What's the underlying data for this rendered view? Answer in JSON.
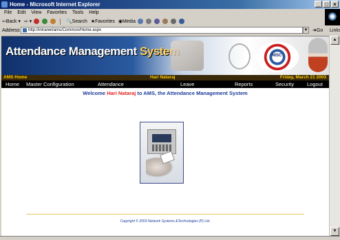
{
  "window": {
    "title": "Home - Microsoft Internet Explorer"
  },
  "menu": {
    "items": [
      "File",
      "Edit",
      "View",
      "Favorites",
      "Tools",
      "Help"
    ]
  },
  "toolbar": {
    "back_label": "Back",
    "search_label": "Search",
    "favorites_label": "Favorites",
    "media_label": "Media"
  },
  "address": {
    "label": "Address",
    "url": "http://intranet/ams/Common/Home.aspx",
    "go_label": "Go",
    "links_label": "Links"
  },
  "banner": {
    "title_part1": "Attendance Management",
    "title_part2": "System",
    "seal_text": "NISC"
  },
  "infobar": {
    "section": "AMS Home",
    "user": "Hari Nataraj",
    "date": "Friday, March 21 2003"
  },
  "nav": {
    "items": [
      "Home",
      "Master Configuration",
      "Attendance",
      "Leave",
      "Reports",
      "Security",
      "Logout"
    ]
  },
  "welcome": {
    "prefix": "Welcome",
    "name": "Hari Nataraj",
    "suffix": "to AMS, the Attendance Management System"
  },
  "footer": {
    "copyright": "Copyright © 2003 Network Systems &Technologies (P) Ltd."
  },
  "colors": {
    "title_bar": "#0a246a",
    "nav_bg": "#000000",
    "infobar_text": "#ffcc00",
    "welcome_text": "#1a3a9a",
    "name_text": "#e02020"
  }
}
